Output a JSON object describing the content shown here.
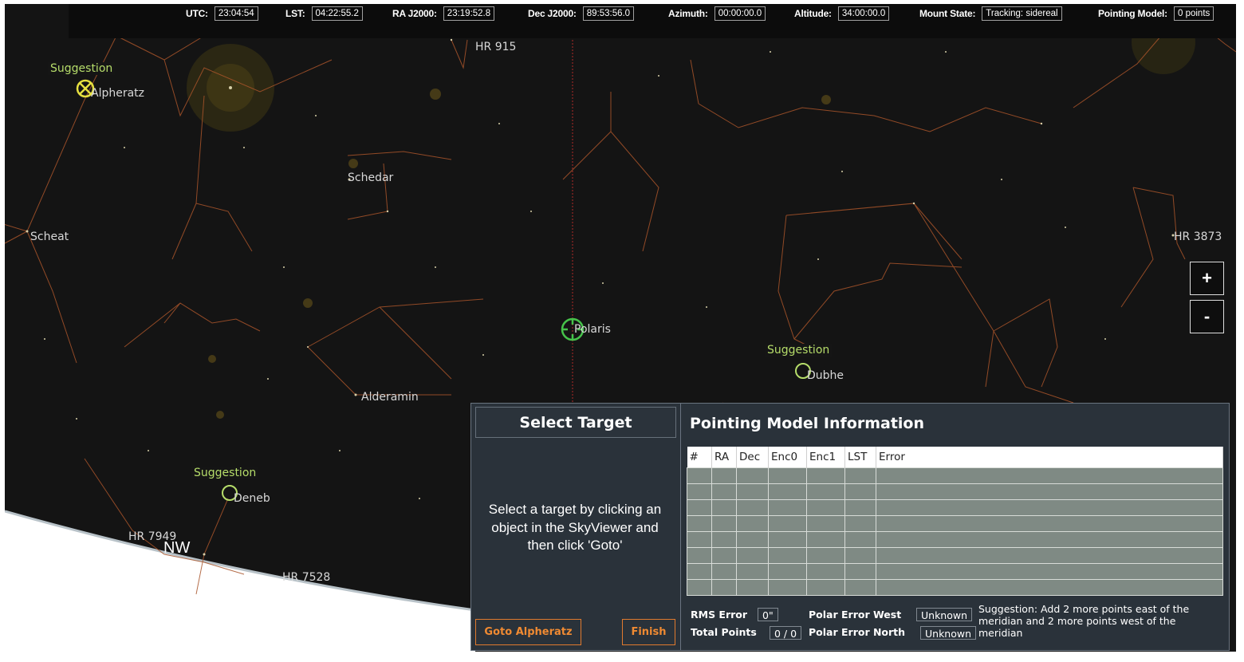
{
  "status_bar": [
    {
      "label": "UTC:",
      "value": "23:04:54"
    },
    {
      "label": "LST:",
      "value": "04:22:55.2"
    },
    {
      "label": "RA J2000:",
      "value": "23:19:52.8"
    },
    {
      "label": "Dec J2000:",
      "value": "89:53:56.0"
    },
    {
      "label": "Azimuth:",
      "value": "00:00:00.0"
    },
    {
      "label": "Altitude:",
      "value": "34:00:00.0"
    },
    {
      "label": "Mount State:",
      "value": "Tracking: sidereal"
    },
    {
      "label": "Pointing Model:",
      "value": "0 points"
    }
  ],
  "sky": {
    "stars": {
      "hr915": "HR 915",
      "alpheratz": "Alpheratz",
      "schedar": "Schedar",
      "scheat": "Scheat",
      "hr3873": "HR 3873",
      "polaris": "Polaris",
      "dubhe": "Dubhe",
      "alderamin": "Alderamin",
      "deneb": "Deneb",
      "hr7949": "HR 7949",
      "hr7528": "HR 7528"
    },
    "suggestion_label": "Suggestion",
    "direction": "NW",
    "colors": {
      "constellation": "#b0562a",
      "suggestion": "#b6dd6a",
      "selected_suggestion": "#e6e040",
      "polaris_marker": "#46c24a",
      "meridian": "#c0302e"
    }
  },
  "zoom": {
    "in": "+",
    "out": "-"
  },
  "select_target": {
    "title": "Select Target",
    "instructions": "Select a target by clicking an object in the SkyViewer and then click 'Goto'",
    "goto_button": "Goto Alpheratz",
    "finish_button": "Finish"
  },
  "pointing_model": {
    "title": "Pointing Model Information",
    "columns": [
      "#",
      "RA",
      "Dec",
      "Enc0",
      "Enc1",
      "LST",
      "Error"
    ],
    "rms_label": "RMS Error",
    "rms_value": "0\"",
    "total_label": "Total Points",
    "total_value": "0 / 0",
    "polar_west_label": "Polar Error West",
    "polar_west_value": "Unknown",
    "polar_north_label": "Polar Error North",
    "polar_north_value": "Unknown",
    "suggestion": "Suggestion: Add 2 more points east of the meridian and 2 more points west of the meridian"
  }
}
